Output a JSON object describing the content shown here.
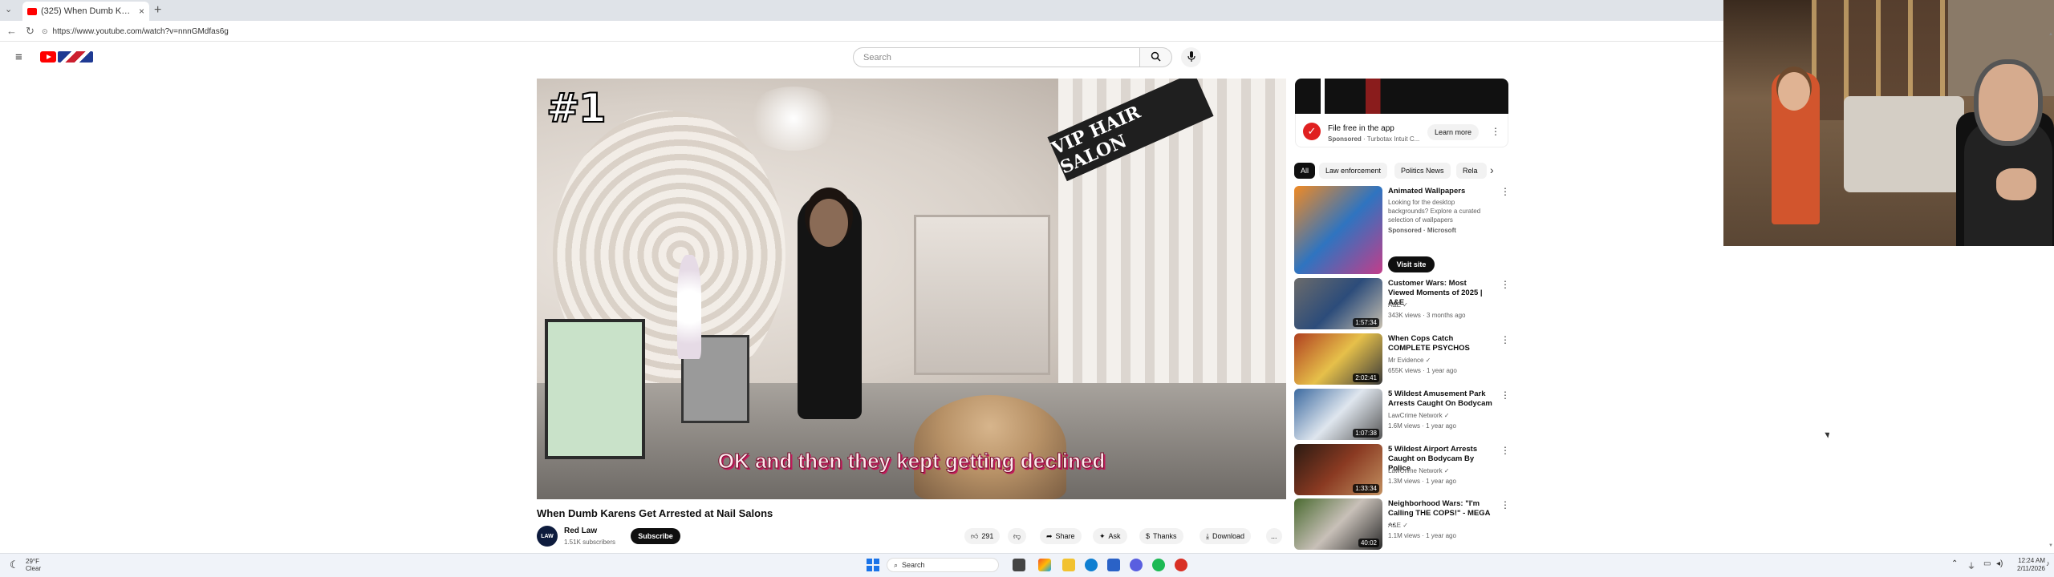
{
  "browser": {
    "tab_title": "(325) When Dumb Karens Get",
    "tab_close": "×",
    "new_tab": "+",
    "url": "https://www.youtube.com/watch?v=nnnGMdfas6g"
  },
  "header": {
    "search_placeholder": "Search"
  },
  "video": {
    "badge": "#1",
    "sign_text": "VIP HAIR SALON",
    "caption": "OK and then they kept getting declined",
    "title": "When Dumb Karens Get Arrested at Nail Salons",
    "channel_name": "Red Law",
    "channel_avatar": "LAW",
    "subscribers": "1.51K subscribers",
    "subscribe_label": "Subscribe",
    "actions": {
      "like_count": "291",
      "share": "Share",
      "ask": "Ask",
      "thanks": "Thanks",
      "download": "Download",
      "more": "..."
    }
  },
  "ad": {
    "title": "File free in the app",
    "sponsored": "Sponsored",
    "advertiser": "Turbotax Intuit C...",
    "button": "Learn more"
  },
  "chips": [
    "All",
    "Law enforcement",
    "Politics News",
    "Rela"
  ],
  "recommended": [
    {
      "title": "Animated Wallpapers",
      "desc": "Looking for the desktop backgrounds? Explore a curated selection of wallpapers",
      "channel": "Sponsored · Microsoft",
      "meta": "",
      "duration": "",
      "visit": "Visit site",
      "colors": [
        "#f08a24",
        "#2f74c0",
        "#c23d8a"
      ]
    },
    {
      "title": "Customer Wars: Most Viewed Moments of 2025 | A&E",
      "channel": "A&E ✓",
      "meta": "343K views · 3 months ago",
      "duration": "1:57:34",
      "colors": [
        "#6b6b6b",
        "#2c4c7a",
        "#c8c0b0"
      ]
    },
    {
      "title": "When Cops Catch COMPLETE PSYCHOS",
      "channel": "Mr Evidence ✓",
      "meta": "655K views · 1 year ago",
      "duration": "2:02:41",
      "colors": [
        "#b04020",
        "#e6c04a",
        "#3a3a3a"
      ]
    },
    {
      "title": "5 Wildest Amusement Park Arrests Caught On Bodycam",
      "channel": "LawCrime Network ✓",
      "meta": "1.6M views · 1 year ago",
      "duration": "1:07:38",
      "colors": [
        "#3c6aa0",
        "#dfe6ee",
        "#555"
      ]
    },
    {
      "title": "5 Wildest Airport Arrests Caught on Bodycam By Police",
      "channel": "LawCrime Network ✓",
      "meta": "1.3M views · 1 year ago",
      "duration": "1:33:34",
      "colors": [
        "#2a1a12",
        "#8a3a22",
        "#c29060"
      ]
    },
    {
      "title": "Neighborhood Wars: \"I'm Calling THE COPS!\" - MEGA ...",
      "channel": "A&E ✓",
      "meta": "1.1M views · 1 year ago",
      "duration": "40:02",
      "colors": [
        "#4a6a30",
        "#c8c0b8",
        "#2a2a2a"
      ]
    }
  ],
  "taskbar": {
    "weather_temp": "29°F",
    "weather_desc": "Clear",
    "search": "Search",
    "time": "12:24 AM",
    "date": "2/11/2026"
  }
}
